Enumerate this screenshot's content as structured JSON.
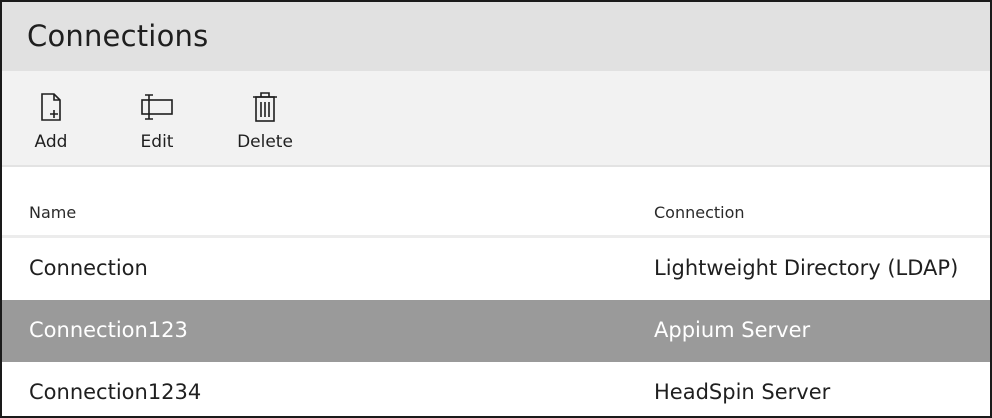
{
  "header": {
    "title": "Connections"
  },
  "toolbar": {
    "add": {
      "label": "Add",
      "icon": "add-document-icon"
    },
    "edit": {
      "label": "Edit",
      "icon": "edit-rename-icon"
    },
    "delete": {
      "label": "Delete",
      "icon": "trash-icon"
    }
  },
  "table": {
    "columns": {
      "name": "Name",
      "connection": "Connection"
    },
    "rows": [
      {
        "name": "Connection",
        "connection": "Lightweight Directory (LDAP)",
        "selected": false
      },
      {
        "name": "Connection123",
        "connection": "Appium Server",
        "selected": true
      },
      {
        "name": "Connection1234",
        "connection": "HeadSpin Server",
        "selected": false
      }
    ]
  },
  "colors": {
    "header_bg": "#e1e1e1",
    "toolbar_bg": "#f2f2f2",
    "selected_row_bg": "#9a9a9a",
    "selected_row_text": "#ffffff"
  }
}
